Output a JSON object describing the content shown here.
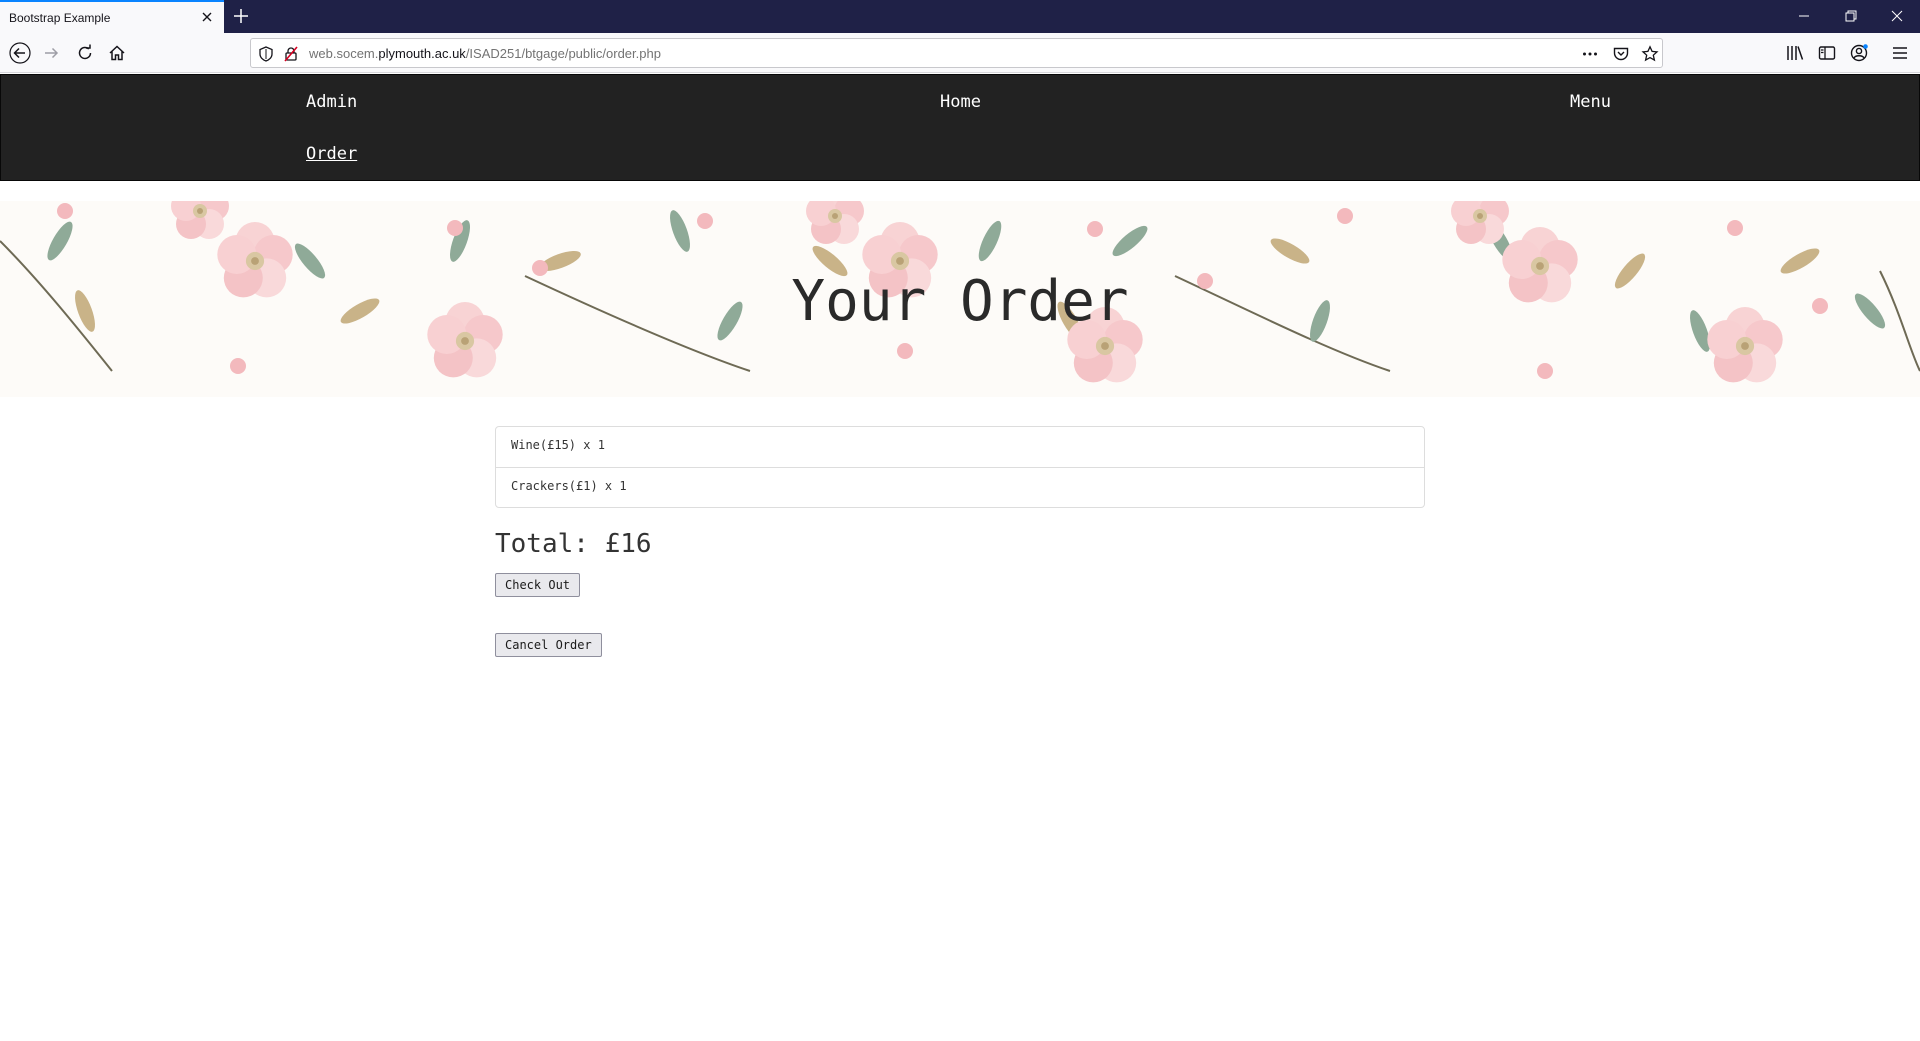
{
  "browser": {
    "tab_title": "Bootstrap Example",
    "url_prefix": "web.socem.",
    "url_host": "plymouth.ac.uk",
    "url_path": "/ISAD251/btgage/public/order.php",
    "icons": [
      "back-icon",
      "forward-icon",
      "reload-icon",
      "home-icon",
      "shield-icon",
      "insecure-lock-icon",
      "more-icon",
      "pocket-icon",
      "bookmark-star-icon",
      "library-icon",
      "sidebar-icon",
      "account-icon",
      "menu-icon"
    ]
  },
  "site_nav": {
    "admin": "Admin",
    "home": "Home",
    "menu": "Menu",
    "order": "Order"
  },
  "hero": {
    "title": "Your Order"
  },
  "order": {
    "items": [
      "Wine(£15) x 1",
      "Crackers(£1) x 1"
    ],
    "total": "Total: £16",
    "checkout_label": "Check Out",
    "cancel_label": "Cancel Order"
  },
  "colors": {
    "navbar_bg": "#222222",
    "tabbar_bg": "#1f2147",
    "accent": "#0a84ff"
  }
}
